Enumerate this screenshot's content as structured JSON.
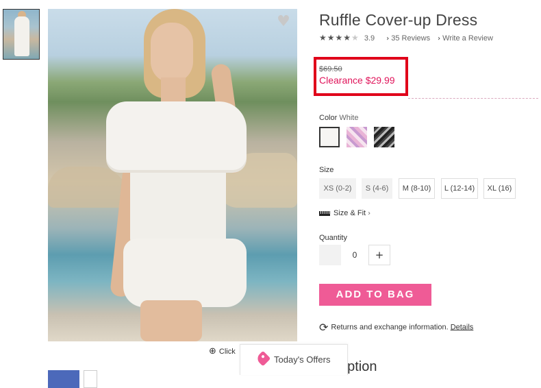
{
  "product": {
    "title": "Ruffle Cover-up Dress",
    "rating_value": "3.9",
    "rating_stars": 3.9,
    "reviews_link": "35 Reviews",
    "write_review_link": "Write a Review"
  },
  "price": {
    "original": "$69.50",
    "clearance": "Clearance $29.99"
  },
  "color": {
    "label": "Color",
    "selected": "White"
  },
  "size": {
    "label": "Size",
    "options": [
      "XS (0-2)",
      "S (4-6)",
      "M (8-10)",
      "L (12-14)",
      "XL (16)"
    ],
    "size_fit_link": "Size & Fit"
  },
  "quantity": {
    "label": "Quantity",
    "value": "0",
    "plus": "+"
  },
  "add_to_bag": "ADD TO BAG",
  "returns": {
    "text": "Returns and exchange information.",
    "link": "Details"
  },
  "image_zoom_text": "Click",
  "description_heading": "cription",
  "todays_offers": "Today's Offers",
  "colors": {
    "accent_pink": "#ef5b96",
    "price_red": "#e0145a",
    "highlight_box": "#e0001a"
  }
}
